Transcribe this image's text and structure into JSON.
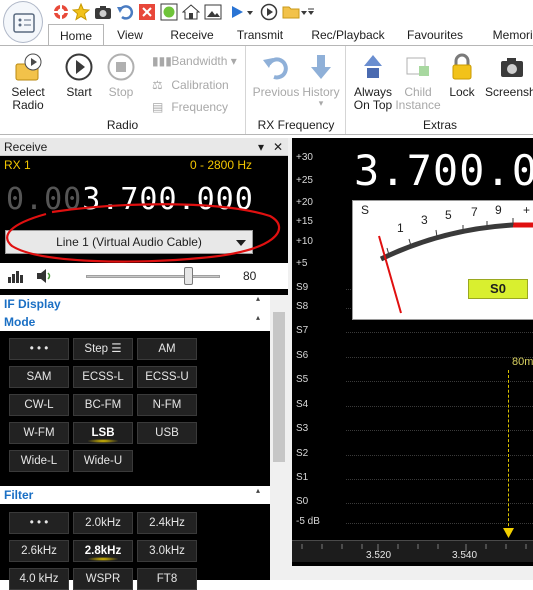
{
  "qat": {
    "icons": [
      "app-menu-icon",
      "lifebuoy-icon",
      "star-icon",
      "camera-icon",
      "undo-icon",
      "close-box-icon",
      "green-circle-icon",
      "home-icon",
      "image-icon",
      "play-icon",
      "play-circle-icon",
      "folder-icon",
      "customize-icon"
    ]
  },
  "tabs": [
    {
      "label": "Home"
    },
    {
      "label": "View"
    },
    {
      "label": "Receive"
    },
    {
      "label": "Transmit"
    },
    {
      "label": "Rec/Playback"
    },
    {
      "label": "Favourites"
    },
    {
      "label": "Memorie"
    }
  ],
  "ribbon": {
    "radio": {
      "label": "Radio",
      "select_radio": "Select Radio",
      "start": "Start",
      "stop": "Stop",
      "bandwidth": "Bandwidth",
      "calibration": "Calibration",
      "frequency": "Frequency"
    },
    "rxfreq": {
      "label": "RX Frequency",
      "previous": "Previous",
      "history": "History"
    },
    "extras": {
      "label": "Extras",
      "always_on_top": "Always On Top",
      "child_instance": "Child Instance",
      "lock": "Lock",
      "screenshot": "Screensh"
    }
  },
  "receive": {
    "title": "Receive",
    "rx_label": "RX 1",
    "range": "0 - 2800 Hz",
    "freq_dim": "0.00",
    "freq_bright": "3.700.000",
    "audio_device": "Line 1 (Virtual Audio Cable)",
    "volume_value": "80",
    "volume_level": 0.8
  },
  "if_display": {
    "label": "IF Display"
  },
  "mode": {
    "label": "Mode",
    "buttons": [
      "• • •",
      "Step ☰",
      "AM",
      "SAM",
      "ECSS-L",
      "ECSS-U",
      "CW-L",
      "BC-FM",
      "N-FM",
      "W-FM",
      "LSB",
      "USB",
      "Wide-L",
      "Wide-U"
    ],
    "selected": "LSB"
  },
  "filter": {
    "label": "Filter",
    "buttons": [
      "• • •",
      "2.0kHz",
      "2.4kHz",
      "2.6kHz",
      "2.8kHz",
      "3.0kHz",
      "4.0 kHz",
      "WSPR",
      "FT8"
    ],
    "selected": "2.8kHz"
  },
  "spectrum": {
    "freq_display": "3.700.0",
    "scale": [
      "+30",
      "+25",
      "+20",
      "+15",
      "+10",
      "+5",
      "S9",
      "S8",
      "S7",
      "S6",
      "S5",
      "S4",
      "S3",
      "S2",
      "S1",
      "S0",
      "-5 dB"
    ],
    "meter_scale": [
      "S",
      "1",
      "3",
      "5",
      "7",
      "9",
      "+"
    ],
    "meter_readout": "S0",
    "band_label": "80m",
    "x_ticks": [
      "3.520",
      "3.540"
    ]
  },
  "colors": {
    "accent_blue": "#1a6fc4",
    "freq_yellow": "#f3c600",
    "annotation_red": "#e01010",
    "meter_green": "#d9ef2f"
  }
}
